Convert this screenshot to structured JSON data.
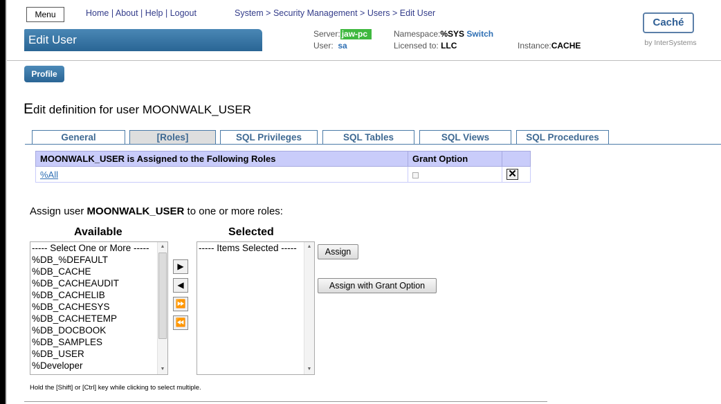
{
  "header": {
    "menu_label": "Menu",
    "nav": [
      "Home",
      "About",
      "Help",
      "Logout"
    ],
    "breadcrumb": [
      "System",
      "Security Management",
      "Users",
      "Edit User"
    ],
    "breadcrumb_sep": ">",
    "title": "Edit User",
    "server_label": "Server:",
    "server_value": "jaw-pc",
    "user_label": "User:",
    "user_value": "sa",
    "namespace_label": "Namespace:",
    "namespace_value": "%SYS",
    "switch_label": "Switch",
    "licensed_label": "Licensed to:",
    "licensed_value": "LLC",
    "instance_label": "Instance:",
    "instance_value": "CACHE",
    "logo_text": "Caché",
    "logo_sub": "by InterSystems"
  },
  "profile_button": "Profile",
  "page_title_first": "E",
  "page_title_rest": "dit definition for user MOONWALK_USER",
  "tabs": [
    "General",
    "[Roles]",
    "SQL Privileges",
    "SQL Tables",
    "SQL Views",
    "SQL Procedures"
  ],
  "active_tab": "[Roles]",
  "roles_table": {
    "headers": [
      "MOONWALK_USER is Assigned to the Following Roles",
      "Grant Option",
      ""
    ],
    "rows": [
      {
        "role": "%All",
        "grant": false,
        "remove_label": "✕"
      }
    ]
  },
  "assign": {
    "prefix": "Assign user ",
    "user": "MOONWALK_USER",
    "suffix": " to one or more roles:",
    "available_heading": "Available",
    "selected_heading": "Selected",
    "available_items": [
      "----- Select One or More -----",
      "%DB_%DEFAULT",
      "%DB_CACHE",
      "%DB_CACHEAUDIT",
      "%DB_CACHELIB",
      "%DB_CACHESYS",
      "%DB_CACHETEMP",
      "%DB_DOCBOOK",
      "%DB_SAMPLES",
      "%DB_USER",
      "%Developer"
    ],
    "selected_items": [
      "----- Items Selected -----"
    ],
    "arrow_icons": [
      "▶",
      "◀",
      "⏩",
      "⏪"
    ],
    "assign_button": "Assign",
    "assign_grant_button": "Assign with Grant Option",
    "hint": "Hold the [Shift] or [Ctrl] key while clicking to select multiple."
  }
}
